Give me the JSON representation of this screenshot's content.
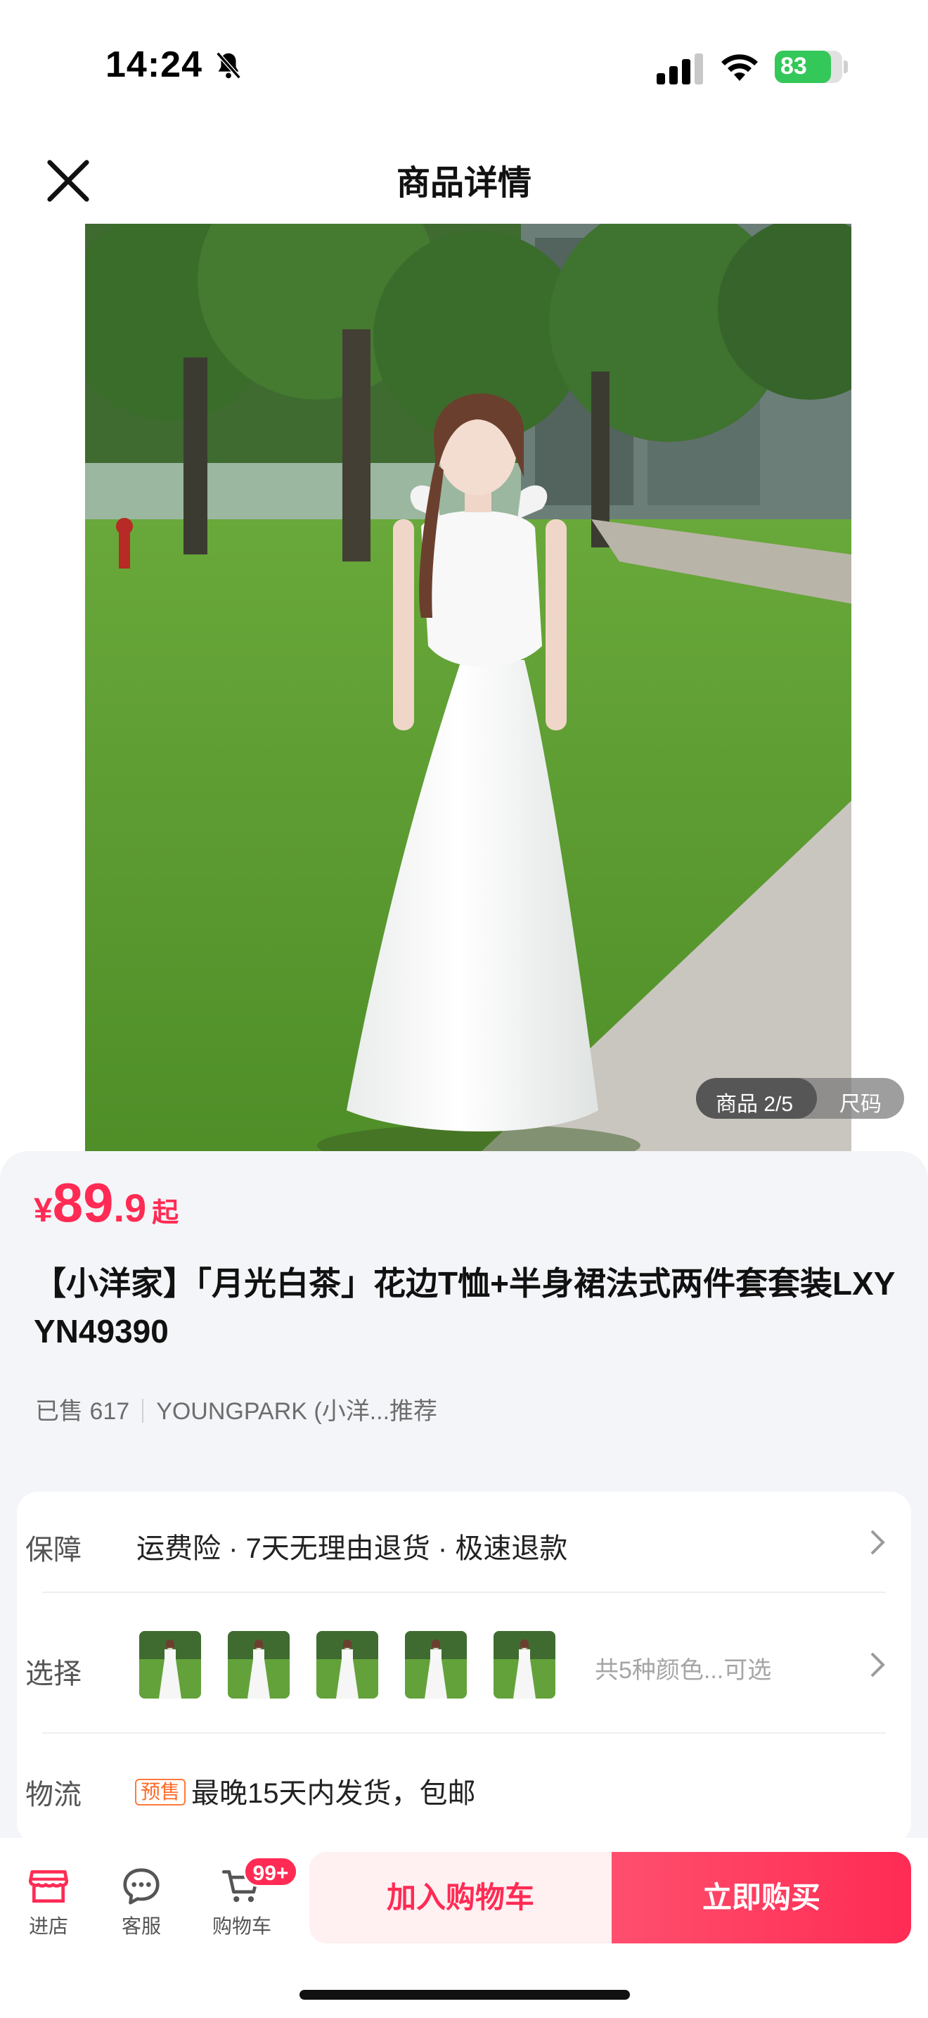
{
  "status_bar": {
    "time": "14:24",
    "battery_level": "83",
    "battery_fraction": 0.83,
    "icons": [
      "bell-muted-icon",
      "cellular-signal-icon",
      "wifi-icon",
      "battery-icon"
    ]
  },
  "header": {
    "title": "商品详情",
    "close_icon": "close-icon"
  },
  "gallery": {
    "counter_label": "商品 2/5",
    "size_label": "尺码"
  },
  "product": {
    "price_symbol": "¥",
    "price_integer": "89",
    "price_decimal": ".9",
    "price_suffix": "起",
    "title": "【小洋家】「月光白茶」花边T恤+半身裙法式两件套套装LXYYN49390",
    "sold": "已售 617",
    "shop": "YOUNGPARK (小洋...推荐"
  },
  "details": {
    "guarantee": {
      "label": "保障",
      "text": "运费险 · 7天无理由退货 · 极速退款"
    },
    "select": {
      "label": "选择",
      "more_text": "共5种颜色...可选",
      "thumbnail_count": 5
    },
    "shipping": {
      "label": "物流",
      "badge": "预售",
      "text": "最晚15天内发货，包邮"
    }
  },
  "bottom_bar": {
    "store_label": "进店",
    "service_label": "客服",
    "cart_label": "购物车",
    "cart_badge": "99+",
    "add_to_cart": "加入购物车",
    "buy_now": "立即购买"
  },
  "colors": {
    "accent": "#ff2b54",
    "background": "#f4f5f8",
    "presale": "#ff6a28",
    "battery": "#34c759"
  }
}
